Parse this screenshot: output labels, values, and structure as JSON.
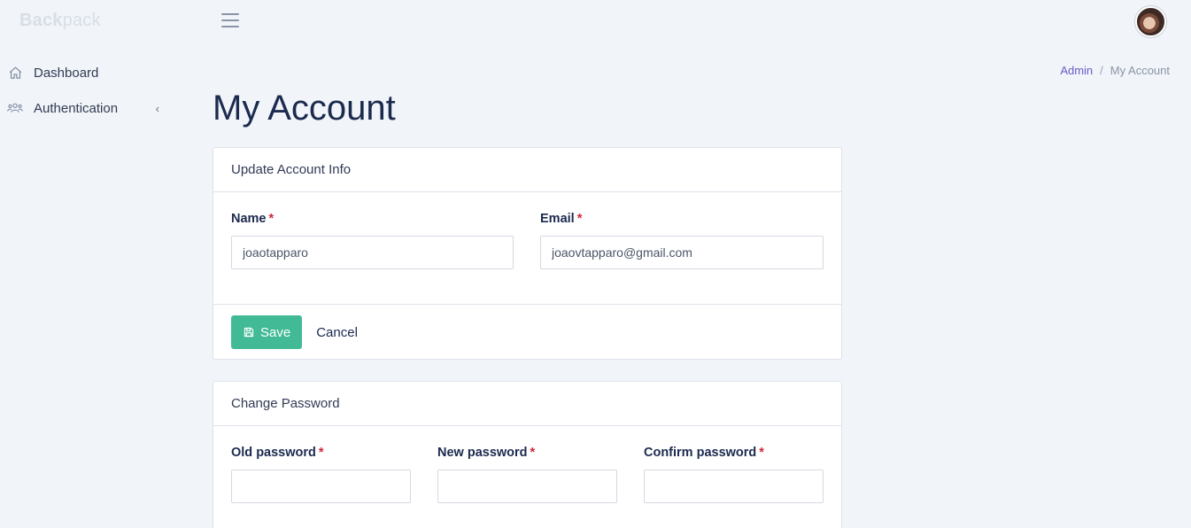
{
  "brand": {
    "bold": "Back",
    "light": "pack"
  },
  "sidebar": {
    "items": [
      {
        "label": "Dashboard",
        "icon": "home-icon"
      },
      {
        "label": "Authentication",
        "icon": "users-icon",
        "chevron": "‹"
      }
    ]
  },
  "breadcrumb": {
    "root": "Admin",
    "separator": "/",
    "current": "My Account"
  },
  "page": {
    "title": "My Account"
  },
  "account_card": {
    "header": "Update Account Info",
    "name": {
      "label": "Name",
      "required_mark": "*",
      "value": "joaotapparo"
    },
    "email": {
      "label": "Email",
      "required_mark": "*",
      "value": "joaovtapparo@gmail.com"
    },
    "save_label": "Save",
    "cancel_label": "Cancel"
  },
  "password_card": {
    "header": "Change Password",
    "old": {
      "label": "Old password",
      "required_mark": "*",
      "value": ""
    },
    "new": {
      "label": "New password",
      "required_mark": "*",
      "value": ""
    },
    "confirm": {
      "label": "Confirm password",
      "required_mark": "*",
      "value": ""
    }
  },
  "colors": {
    "accent": "#6a5ac8",
    "save": "#42ba96",
    "required": "#d0273a",
    "background": "#f1f4f8"
  }
}
